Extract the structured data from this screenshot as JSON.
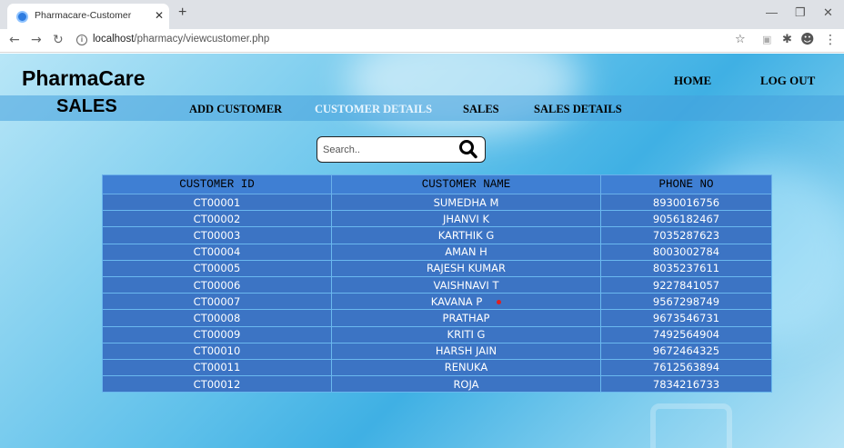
{
  "browser": {
    "tab_title": "Pharmacare-Customer",
    "url_host": "localhost",
    "url_path": "/pharmacy/viewcustomer.php",
    "new_tab": "+",
    "tab_close": "✕"
  },
  "header": {
    "brand": "PharmaCare",
    "home_link": "HOME",
    "logout_link": "LOG OUT"
  },
  "menu": {
    "section_title": "SALES",
    "items": [
      {
        "label": "ADD CUSTOMER",
        "active": false
      },
      {
        "label": "CUSTOMER DETAILS",
        "active": true
      },
      {
        "label": "SALES",
        "active": false
      },
      {
        "label": "SALES DETAILS",
        "active": false
      }
    ]
  },
  "search": {
    "placeholder": "Search..",
    "value": ""
  },
  "table": {
    "columns": [
      "CUSTOMER ID",
      "CUSTOMER NAME",
      "PHONE NO"
    ],
    "rows": [
      [
        "CT00001",
        "SUMEDHA M",
        "8930016756"
      ],
      [
        "CT00002",
        "JHANVI K",
        "9056182467"
      ],
      [
        "CT00003",
        "KARTHIK G",
        "7035287623"
      ],
      [
        "CT00004",
        "AMAN H",
        "8003002784"
      ],
      [
        "CT00005",
        "RAJESH KUMAR",
        "8035237611"
      ],
      [
        "CT00006",
        "VAISHNAVI T",
        "9227841057"
      ],
      [
        "CT00007",
        "KAVANA P",
        "9567298749"
      ],
      [
        "CT00008",
        "PRATHAP",
        "9673546731"
      ],
      [
        "CT00009",
        "KRITI G",
        "7492564904"
      ],
      [
        "CT00010",
        "HARSH JAIN",
        "9672464325"
      ],
      [
        "CT00011",
        "RENUKA",
        "7612563894"
      ],
      [
        "CT00012",
        "ROJA",
        "7834216733"
      ]
    ]
  },
  "colors": {
    "table_header": "#3f7fd3",
    "table_row": "#3c74c4",
    "active_menu": "#e8f6ff"
  }
}
